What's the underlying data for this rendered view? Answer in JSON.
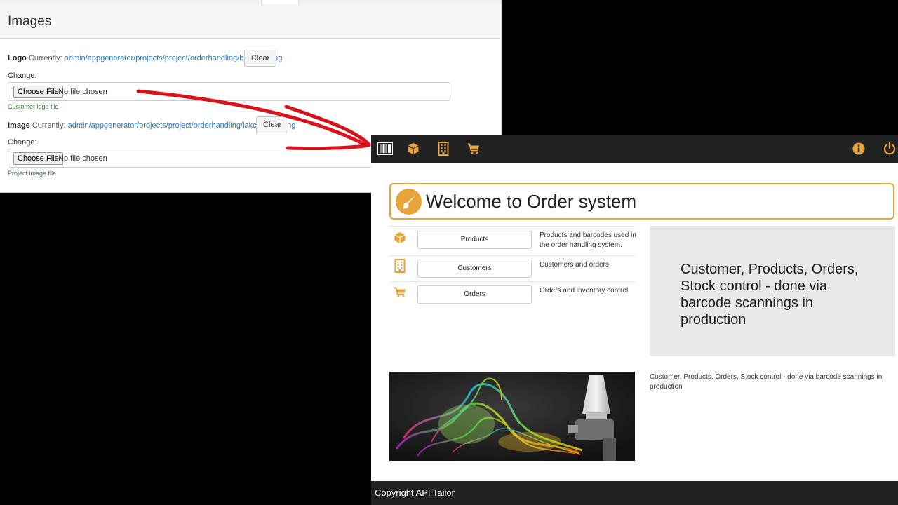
{
  "admin": {
    "section_title": "Images",
    "logo": {
      "label": "Logo",
      "currently": "Currently:",
      "path": "admin/appgenerator/projects/project/orderhandling/barcode.png",
      "clear_label": "Clear",
      "change_label": "Change:",
      "choose_label": "Choose File",
      "no_file": "No file chosen",
      "help": "Customer logo file"
    },
    "image": {
      "label": "Image",
      "currently": "Currently:",
      "path": "admin/appgenerator/projects/project/orderhandling/lakcenteret.png",
      "clear_label": "Clear",
      "change_label": "Change:",
      "choose_label": "Choose File",
      "no_file": "No file chosen",
      "help": "Project image file"
    }
  },
  "app": {
    "colors": {
      "accent": "#e8a33a",
      "navbar": "#222222",
      "panel": "#e8e8e8",
      "arrow": "#d9111b"
    },
    "navbar": {
      "icons_left": [
        "barcode-icon",
        "cube-icon",
        "building-icon",
        "cart-icon"
      ],
      "icons_right": [
        "info-icon",
        "power-icon"
      ]
    },
    "welcome": {
      "icon": "paintbrush-icon",
      "title": "Welcome to Order system"
    },
    "menu": [
      {
        "icon": "cube-icon",
        "label": "Products",
        "description": "Products and barcodes used in the order handling system."
      },
      {
        "icon": "building-icon",
        "label": "Customers",
        "description": "Customers and orders"
      },
      {
        "icon": "cart-icon",
        "label": "Orders",
        "description": "Orders and inventory control"
      }
    ],
    "panel_text": "Customer, Products, Orders, Stock control - done via barcode scannings in production",
    "caption": "Customer, Products, Orders, Stock control - done via barcode scannings in production",
    "hero_image": "spray-gun-color-smoke-image",
    "footer": "Copyright API Tailor"
  }
}
